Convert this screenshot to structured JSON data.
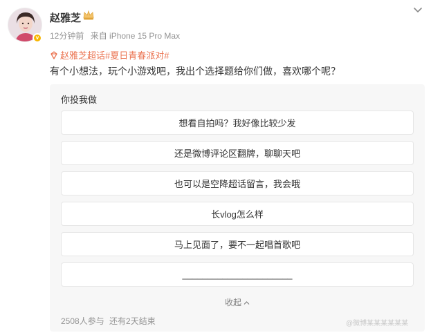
{
  "author": {
    "name": "赵雅芝",
    "time": "12分钟前",
    "source": "来自 iPhone 15 Pro Max",
    "verified_mark": "v"
  },
  "post": {
    "topics": [
      "赵雅芝超话",
      "#夏日青春派对#"
    ],
    "text": "有个小想法，玩个小游戏吧，我出个选择题给你们做，喜欢哪个呢？"
  },
  "vote": {
    "title": "你投我做",
    "options": [
      "想看自拍吗？我好像比较少发",
      "还是微博评论区翻牌，聊聊天吧",
      "也可以是空降超话留言，我会哦",
      "长vlog怎么样",
      "马上见面了，要不一起唱首歌吧",
      "______________________"
    ],
    "collapse_label": "收起",
    "participants": "2508人参与",
    "remaining": "还有2天结束"
  },
  "watermark": "@微博某某某某某某",
  "colors": {
    "topic": "#eb7350",
    "card_bg": "#f7f7f7",
    "meta_gray": "#939393",
    "verified": "#f7b500"
  },
  "icons": {
    "more": "chevron-down-icon",
    "crown": "crown-icon",
    "topic": "super-topic-icon"
  }
}
